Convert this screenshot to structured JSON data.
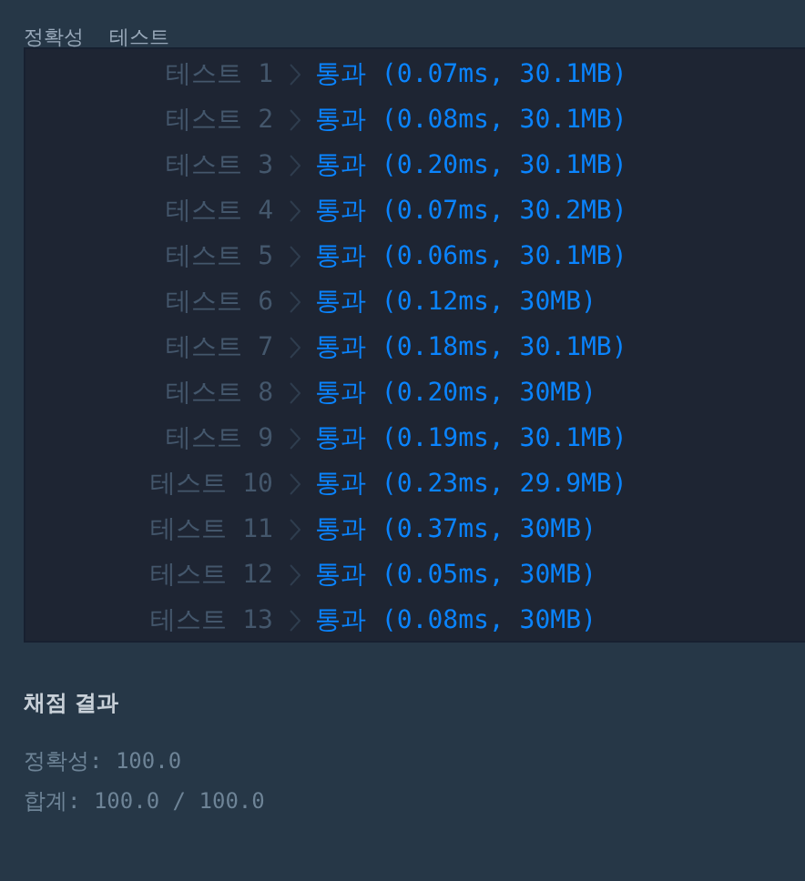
{
  "tabs_header": [
    "정확성",
    "테스트"
  ],
  "tests": [
    {
      "label": "테스트 1",
      "result": "통과 (0.07ms, 30.1MB)",
      "passed": true
    },
    {
      "label": "테스트 2",
      "result": "통과 (0.08ms, 30.1MB)",
      "passed": true
    },
    {
      "label": "테스트 3",
      "result": "통과 (0.20ms, 30.1MB)",
      "passed": true
    },
    {
      "label": "테스트 4",
      "result": "통과 (0.07ms, 30.2MB)",
      "passed": true
    },
    {
      "label": "테스트 5",
      "result": "통과 (0.06ms, 30.1MB)",
      "passed": true
    },
    {
      "label": "테스트 6",
      "result": "통과 (0.12ms, 30MB)",
      "passed": true
    },
    {
      "label": "테스트 7",
      "result": "통과 (0.18ms, 30.1MB)",
      "passed": true
    },
    {
      "label": "테스트 8",
      "result": "통과 (0.20ms, 30MB)",
      "passed": true
    },
    {
      "label": "테스트 9",
      "result": "통과 (0.19ms, 30.1MB)",
      "passed": true
    },
    {
      "label": "테스트 10",
      "result": "통과 (0.23ms, 29.9MB)",
      "passed": true
    },
    {
      "label": "테스트 11",
      "result": "통과 (0.37ms, 30MB)",
      "passed": true
    },
    {
      "label": "테스트 12",
      "result": "통과 (0.05ms, 30MB)",
      "passed": true
    },
    {
      "label": "테스트 13",
      "result": "통과 (0.08ms, 30MB)",
      "passed": true
    }
  ],
  "summary": {
    "title": "채점 결과",
    "lines": [
      "정확성: 100.0",
      "합계: 100.0 / 100.0"
    ]
  }
}
